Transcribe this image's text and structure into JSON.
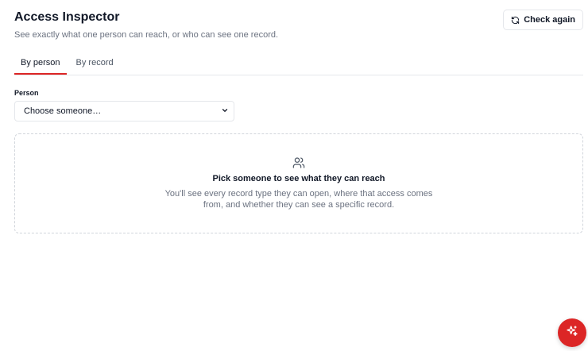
{
  "header": {
    "title": "Access Inspector",
    "subtitle": "See exactly what one person can reach, or who can see one record.",
    "check_again_label": "Check again"
  },
  "tabs": [
    {
      "label": "By person",
      "active": true
    },
    {
      "label": "By record",
      "active": false
    }
  ],
  "person_field": {
    "label": "Person",
    "selected": "Choose someone…"
  },
  "empty_state": {
    "title": "Pick someone to see what they can reach",
    "description_line1": "You'll see every record type they can open, where that access comes",
    "description_line2": "from, and whether they can see a specific record."
  },
  "icons": {
    "check_again": "refresh-icon",
    "empty_state": "users-icon",
    "select": "chevron-down-icon",
    "fab": "sparkles-icon"
  },
  "colors": {
    "accent": "#dc2626",
    "text_primary": "#111827",
    "text_muted": "#6b7280",
    "border": "#e5e7eb"
  }
}
